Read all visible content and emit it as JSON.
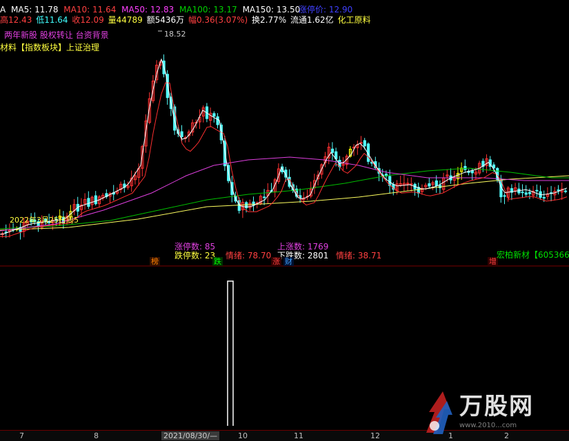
{
  "ma_bar": {
    "prefix": "A",
    "ma5": "MA5: 11.78",
    "ma10": "MA10: 11.64",
    "ma50": "MA50: 12.83",
    "ma100": "MA100: 13.17",
    "ma150": "MA150: 13.50",
    "limit_up": "涨停价: 12.90"
  },
  "quote_bar": {
    "high": "高12.43",
    "low": "低11.64",
    "close": "收12.09",
    "volume": "量44789",
    "amount": "额5436万",
    "change": "幅0.36(3.07%)",
    "turnover": "换2.77%",
    "float": "流通1.62亿",
    "industry": "化工原料"
  },
  "concepts": {
    "line1": "两年新股 股权转让 台资背景",
    "line2": "材料【指数板块】上证治理"
  },
  "price_label": "18.52",
  "date_overlay": "2022年3月25日周5",
  "stats": {
    "limit_up_count": "涨停数: 85",
    "limit_down_count": "跌停数: 23",
    "sentiment1": "情绪: 78.70",
    "up_count": "上涨数: 1769",
    "down_count": "下跌数: 2801",
    "sentiment2": "情绪: 38.71"
  },
  "tags": {
    "bang": "榜",
    "die": "跌",
    "zhang": "涨",
    "cai": "财",
    "zeng": "增",
    "stock": "宏柏新材【605366"
  },
  "axis": {
    "t7": "7",
    "t8": "8",
    "cursor": "2021/08/30/—",
    "t10": "10",
    "t11": "11",
    "t12": "12",
    "t1": "1",
    "t2": "2"
  },
  "watermark": {
    "brand": "万股网",
    "url": "www.2010...com"
  },
  "colors": {
    "up": "#ff3232",
    "down": "#54fcfc",
    "ma5": "#ffffff",
    "ma10": "#e0e020",
    "ma50": "#ff40ff",
    "ma100": "#00c800",
    "ma150": "#ffff60",
    "limit": "#ffff00"
  }
}
